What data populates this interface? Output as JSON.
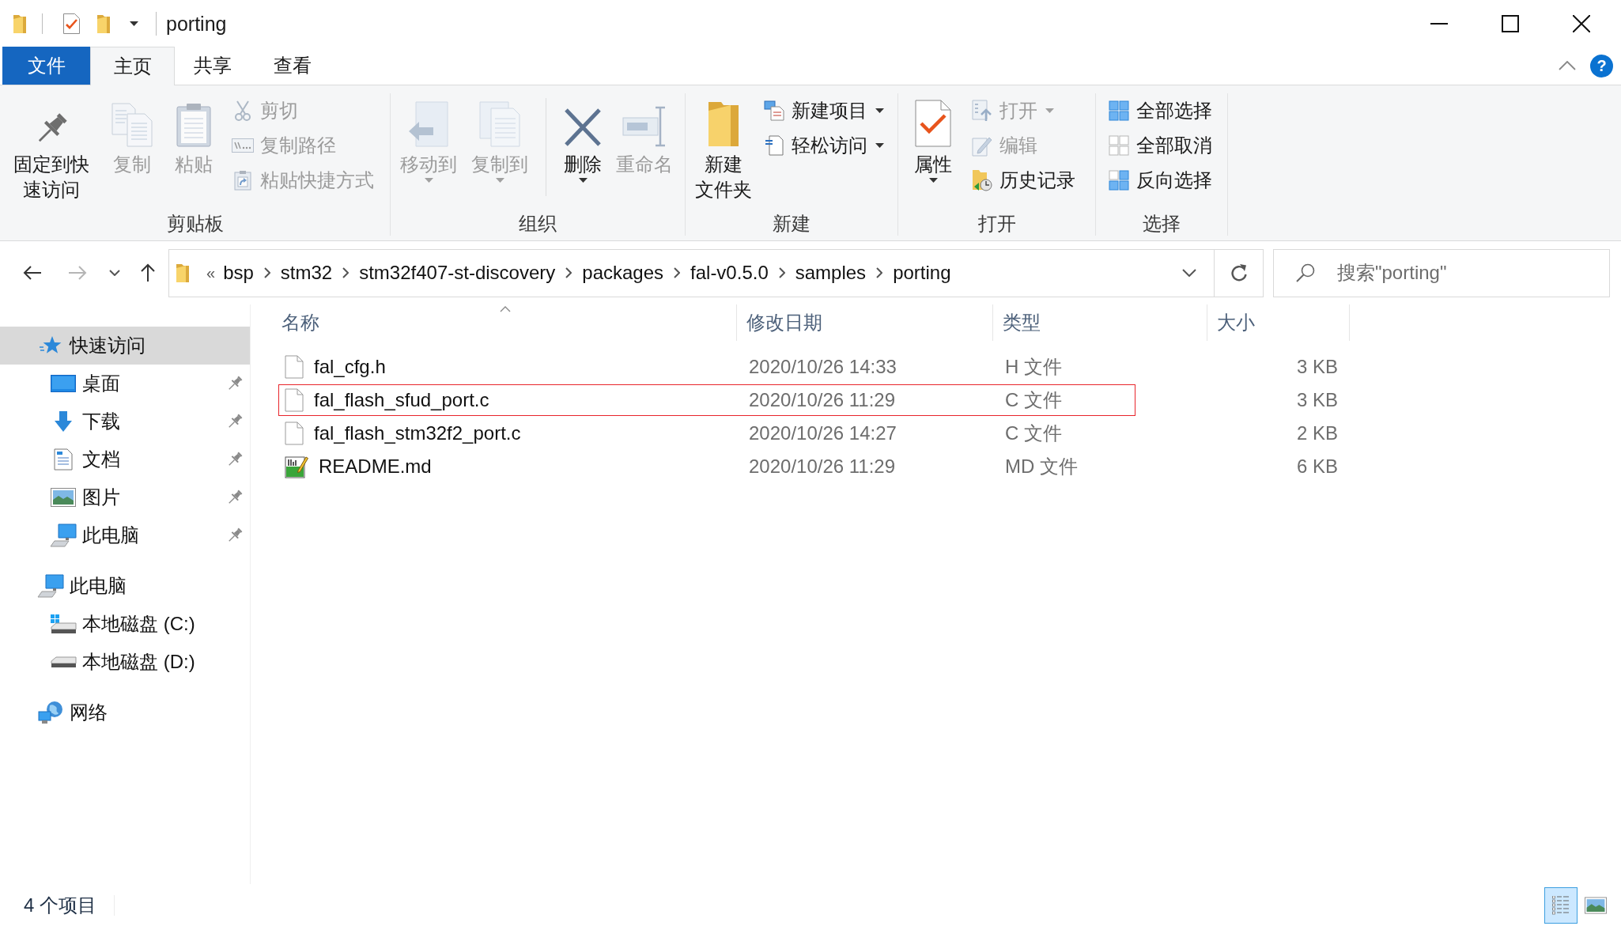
{
  "title_bar": {
    "title": "porting"
  },
  "ribbon_tabs": [
    {
      "label": "文件",
      "kind": "backstage",
      "selected": false
    },
    {
      "label": "主页",
      "kind": "tab",
      "selected": true
    },
    {
      "label": "共享",
      "kind": "tab",
      "selected": false
    },
    {
      "label": "查看",
      "kind": "tab",
      "selected": false
    }
  ],
  "help": "?",
  "ribbon_groups": [
    {
      "label": "剪贴板",
      "items": [
        {
          "kind": "large",
          "label": "固定到快速访问",
          "disabled": false,
          "dropdown": false
        },
        {
          "kind": "large",
          "label": "复制",
          "disabled": true,
          "dropdown": false
        },
        {
          "kind": "large",
          "label": "粘贴",
          "disabled": true,
          "dropdown": false
        },
        {
          "kind": "small",
          "label": "剪切",
          "disabled": true,
          "dropdown": false
        },
        {
          "kind": "small",
          "label": "复制路径",
          "disabled": true,
          "dropdown": false
        },
        {
          "kind": "small",
          "label": "粘贴快捷方式",
          "disabled": true,
          "dropdown": false
        }
      ]
    },
    {
      "label": "组织",
      "items": [
        {
          "kind": "large",
          "label": "移动到",
          "disabled": true,
          "dropdown": true
        },
        {
          "kind": "large",
          "label": "复制到",
          "disabled": true,
          "dropdown": true
        },
        {
          "kind": "separator"
        },
        {
          "kind": "large",
          "label": "删除",
          "disabled": false,
          "dropdown": true
        },
        {
          "kind": "large",
          "label": "重命名",
          "disabled": true,
          "dropdown": false
        }
      ]
    },
    {
      "label": "新建",
      "items": [
        {
          "kind": "large",
          "label": "新建文件夹",
          "disabled": false,
          "dropdown": false
        },
        {
          "kind": "small",
          "label": "新建项目",
          "disabled": false,
          "dropdown": true
        },
        {
          "kind": "small",
          "label": "轻松访问",
          "disabled": false,
          "dropdown": true
        }
      ]
    },
    {
      "label": "打开",
      "items": [
        {
          "kind": "large",
          "label": "属性",
          "disabled": false,
          "dropdown": true
        },
        {
          "kind": "small",
          "label": "打开",
          "disabled": true,
          "dropdown": true
        },
        {
          "kind": "small",
          "label": "编辑",
          "disabled": true,
          "dropdown": false
        },
        {
          "kind": "small",
          "label": "历史记录",
          "disabled": false,
          "dropdown": false
        }
      ]
    },
    {
      "label": "选择",
      "items": [
        {
          "kind": "small",
          "label": "全部选择",
          "disabled": false,
          "dropdown": false
        },
        {
          "kind": "small",
          "label": "全部取消",
          "disabled": false,
          "dropdown": false
        },
        {
          "kind": "small",
          "label": "反向选择",
          "disabled": false,
          "dropdown": false
        }
      ]
    }
  ],
  "navigation": {
    "back": {
      "disabled": false
    },
    "forward": {
      "disabled": true
    }
  },
  "address_bar": {
    "overflow": "«",
    "path": [
      "bsp",
      "stm32",
      "stm32f407-st-discovery",
      "packages",
      "fal-v0.5.0",
      "samples",
      "porting"
    ]
  },
  "search": {
    "placeholder": "搜索\"porting\""
  },
  "navigation_pane": {
    "items": [
      {
        "label": "快速访问",
        "selected": true,
        "pinned": false,
        "children": [
          {
            "label": "桌面",
            "selected": false,
            "pinned": true
          },
          {
            "label": "下载",
            "selected": false,
            "pinned": true
          },
          {
            "label": "文档",
            "selected": false,
            "pinned": true
          },
          {
            "label": "图片",
            "selected": false,
            "pinned": true
          },
          {
            "label": "此电脑",
            "selected": false,
            "pinned": true
          }
        ]
      },
      {
        "label": "此电脑",
        "selected": false,
        "pinned": false,
        "children": [
          {
            "label": "本地磁盘 (C:)",
            "selected": false,
            "pinned": false
          },
          {
            "label": "本地磁盘 (D:)",
            "selected": false,
            "pinned": false
          }
        ]
      },
      {
        "label": "网络",
        "selected": false,
        "pinned": false
      }
    ]
  },
  "file_list": {
    "columns": [
      {
        "label": "名称",
        "sorted": true
      },
      {
        "label": "修改日期",
        "sorted": false
      },
      {
        "label": "类型",
        "sorted": false
      },
      {
        "label": "大小",
        "sorted": false
      }
    ],
    "rows": [
      {
        "name": "fal_cfg.h",
        "modified": "2020/10/26 14:33",
        "type": "H 文件",
        "size": "3 KB",
        "highlighted": false
      },
      {
        "name": "fal_flash_sfud_port.c",
        "modified": "2020/10/26 11:29",
        "type": "C 文件",
        "size": "3 KB",
        "highlighted": true
      },
      {
        "name": "fal_flash_stm32f2_port.c",
        "modified": "2020/10/26 14:27",
        "type": "C 文件",
        "size": "2 KB",
        "highlighted": false
      },
      {
        "name": "README.md",
        "modified": "2020/10/26 11:29",
        "type": "MD 文件",
        "size": "6 KB",
        "highlighted": false
      }
    ]
  },
  "status_bar": {
    "item_count": "4 个项目",
    "views": [
      {
        "selected": true
      },
      {
        "selected": false
      }
    ]
  }
}
